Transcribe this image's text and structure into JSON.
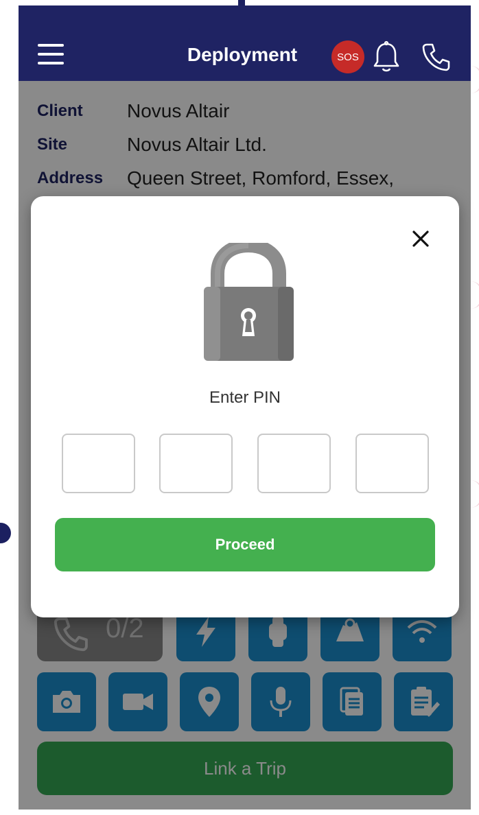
{
  "appbar": {
    "title": "Deployment",
    "sos_label": "SOS",
    "background": "#1f2363"
  },
  "details": {
    "client_label": "Client",
    "client_value": "Novus Altair",
    "site_label": "Site",
    "site_value": "Novus Altair Ltd.",
    "address_label": "Address",
    "address_value": "Queen Street, Romford, Essex,"
  },
  "actions": {
    "call_count": "0/2",
    "tiles_row1": [
      "lightning-icon",
      "watch-icon",
      "map-icon",
      "wifi-icon"
    ],
    "tiles_row2": [
      "camera-icon",
      "video-icon",
      "location-pin-icon",
      "microphone-icon",
      "documents-icon",
      "clipboard-icon"
    ],
    "link_trip_label": "Link a Trip",
    "tile_color": "#1a8fd0",
    "link_trip_color": "#34a853"
  },
  "pin_modal": {
    "prompt": "Enter PIN",
    "pin_digits": [
      "",
      "",
      "",
      ""
    ],
    "proceed_label": "Proceed",
    "proceed_color": "#44b04f"
  }
}
